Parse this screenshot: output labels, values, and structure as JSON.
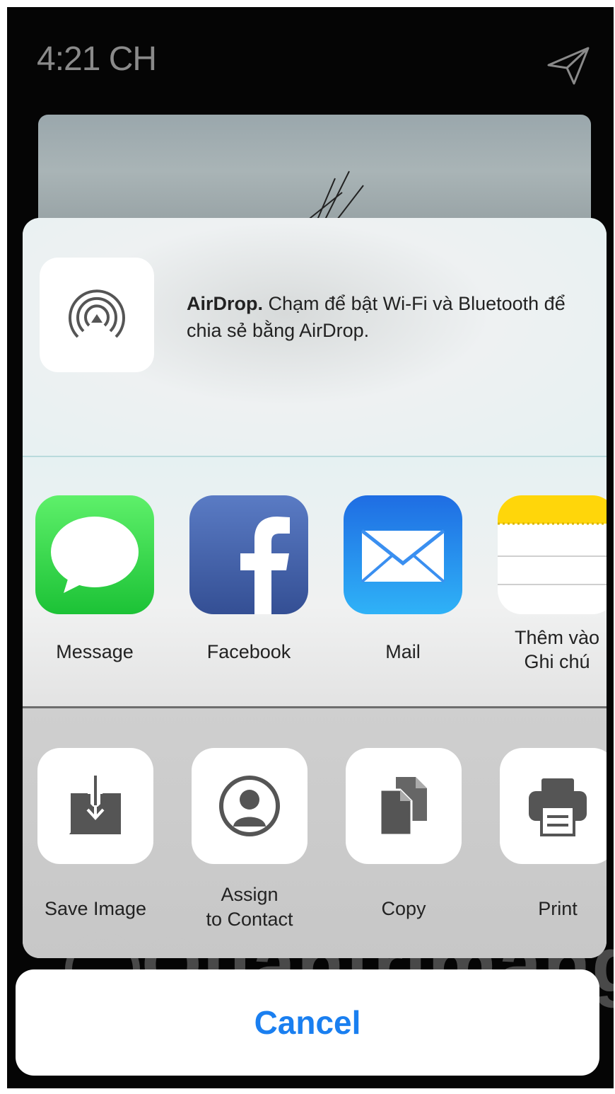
{
  "status_bar": {
    "time": "4:21 CH",
    "send_icon": "paper-plane-icon"
  },
  "airdrop": {
    "title": "AirDrop.",
    "description": "Chạm để bật Wi-Fi và Bluetooth để chia sẻ bằng AirDrop.",
    "icon": "airdrop-icon"
  },
  "share_apps": [
    {
      "label": "Message",
      "icon": "message-icon",
      "color": "#34c759"
    },
    {
      "label": "Facebook",
      "icon": "facebook-icon",
      "color": "#3b5998"
    },
    {
      "label": "Mail",
      "icon": "mail-icon",
      "color": "#1a8cf5"
    },
    {
      "label": "Thêm vào\nGhi chú",
      "line1": "Thêm vào",
      "line2": "Ghi chú",
      "icon": "notes-icon",
      "color": "#ffd60a"
    }
  ],
  "actions": [
    {
      "label": "Save Image",
      "icon": "save-image-icon"
    },
    {
      "label": "Assign\nto Contact",
      "line1": "Assign",
      "line2": "to Contact",
      "icon": "contact-icon"
    },
    {
      "label": "Copy",
      "icon": "copy-icon"
    },
    {
      "label": "Print",
      "icon": "print-icon"
    }
  ],
  "cancel": {
    "label": "Cancel",
    "color": "#1a7ff0"
  },
  "watermark": {
    "text": "Quantrimang"
  }
}
